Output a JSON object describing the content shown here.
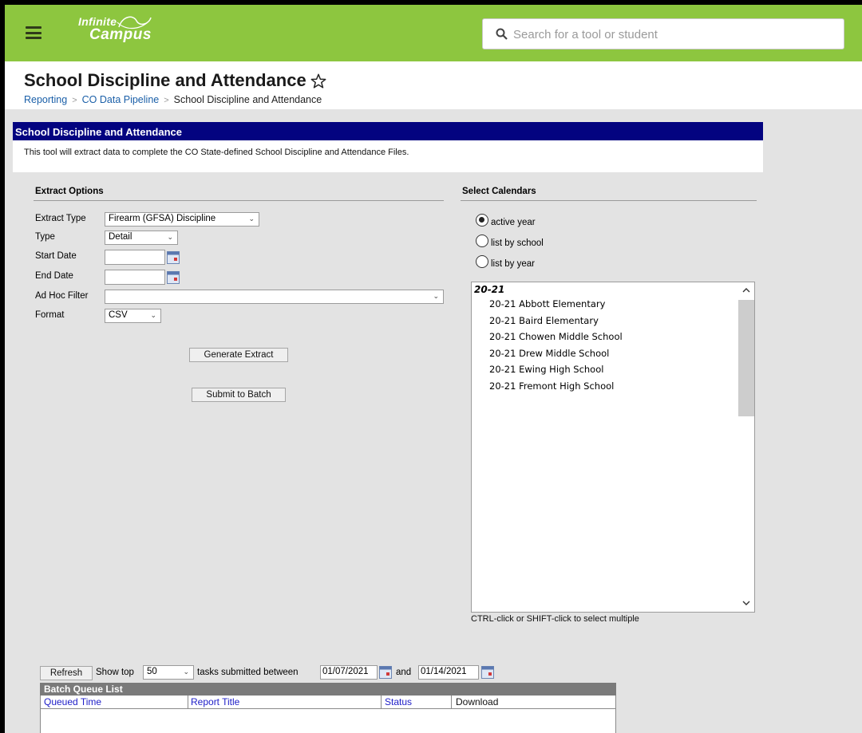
{
  "header": {
    "logo_line1": "Infinite",
    "logo_line2": "Campus",
    "search_placeholder": "Search for a tool or student"
  },
  "page": {
    "title": "School Discipline and Attendance",
    "breadcrumb": [
      "Reporting",
      "CO Data Pipeline",
      "School Discipline and Attendance"
    ]
  },
  "tool": {
    "title": "School Discipline and Attendance",
    "description": "This tool will extract data to complete the CO State-defined School Discipline and Attendance Files."
  },
  "extract_options": {
    "section_title": "Extract Options",
    "extract_type_label": "Extract Type",
    "extract_type_value": "Firearm (GFSA) Discipline",
    "type_label": "Type",
    "type_value": "Detail",
    "start_date_label": "Start Date",
    "start_date_value": "",
    "end_date_label": "End Date",
    "end_date_value": "",
    "ad_hoc_label": "Ad Hoc Filter",
    "ad_hoc_value": "",
    "format_label": "Format",
    "format_value": "CSV",
    "generate_button": "Generate Extract",
    "batch_button": "Submit to Batch"
  },
  "calendars": {
    "section_title": "Select Calendars",
    "radio_options": [
      "active year",
      "list by school",
      "list by year"
    ],
    "selected_radio": "active year",
    "group_label": "20-21",
    "items": [
      "20-21 Abbott Elementary",
      "20-21 Baird Elementary",
      "20-21 Chowen Middle School",
      "20-21 Drew Middle School",
      "20-21 Ewing High School",
      "20-21 Fremont High School"
    ],
    "hint": "CTRL-click or SHIFT-click to select multiple"
  },
  "batch": {
    "refresh_button": "Refresh",
    "show_top_label": "Show top",
    "show_top_value": "50",
    "between_label": "tasks submitted between",
    "start_date": "01/07/2021",
    "and_label": "and",
    "end_date": "01/14/2021",
    "list_title": "Batch Queue List",
    "columns": [
      "Queued Time",
      "Report Title",
      "Status",
      "Download"
    ]
  },
  "colors": {
    "header_green": "#8dc63f",
    "tool_header_navy": "#030380",
    "link_blue": "#1a5fa8"
  }
}
